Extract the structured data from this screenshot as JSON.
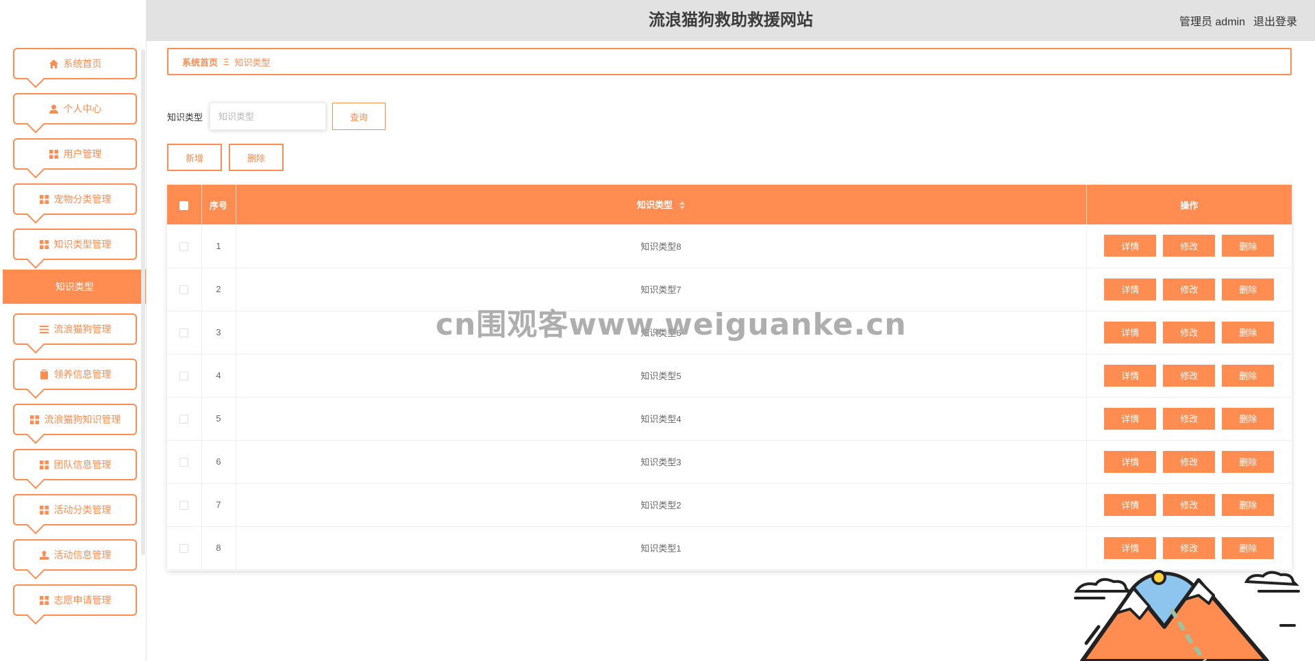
{
  "header": {
    "title": "流浪猫狗救助救援网站",
    "user_label": "管理员 admin",
    "logout_label": "退出登录"
  },
  "sidebar": {
    "items": [
      {
        "label": "系统首页",
        "icon": "home-icon"
      },
      {
        "label": "个人中心",
        "icon": "user-icon"
      },
      {
        "label": "用户管理",
        "icon": "grid-icon"
      },
      {
        "label": "宠物分类管理",
        "icon": "grid-icon"
      },
      {
        "label": "知识类型管理",
        "icon": "grid-icon",
        "submenu": [
          "知识类型"
        ]
      },
      {
        "label": "流浪猫狗管理",
        "icon": "list-icon"
      },
      {
        "label": "领养信息管理",
        "icon": "clipboard-icon"
      },
      {
        "label": "流浪猫狗知识管理",
        "icon": "grid-icon"
      },
      {
        "label": "团队信息管理",
        "icon": "grid-icon"
      },
      {
        "label": "活动分类管理",
        "icon": "grid-icon"
      },
      {
        "label": "活动信息管理",
        "icon": "stamp-icon"
      },
      {
        "label": "志愿申请管理",
        "icon": "grid-icon"
      }
    ],
    "active_submenu": "知识类型"
  },
  "breadcrumb": {
    "home": "系统首页",
    "separator": "Ξ",
    "current": "知识类型"
  },
  "search": {
    "label": "知识类型",
    "placeholder": "知识类型",
    "value": "",
    "button_label": "查询"
  },
  "actions": {
    "add_label": "新增",
    "delete_label": "删除"
  },
  "table": {
    "headers": {
      "index": "序号",
      "type": "知识类型",
      "ops": "操作"
    },
    "rows": [
      {
        "index": "1",
        "type": "知识类型8"
      },
      {
        "index": "2",
        "type": "知识类型7"
      },
      {
        "index": "3",
        "type": "知识类型6"
      },
      {
        "index": "4",
        "type": "知识类型5"
      },
      {
        "index": "5",
        "type": "知识类型4"
      },
      {
        "index": "6",
        "type": "知识类型3"
      },
      {
        "index": "7",
        "type": "知识类型2"
      },
      {
        "index": "8",
        "type": "知识类型1"
      }
    ],
    "op_labels": {
      "detail": "详情",
      "edit": "修改",
      "delete": "删除"
    }
  },
  "watermark": "cn围观客www.weiguanke.cn",
  "colors": {
    "accent": "#ff8c50",
    "header_bg": "#e2e2e2"
  }
}
